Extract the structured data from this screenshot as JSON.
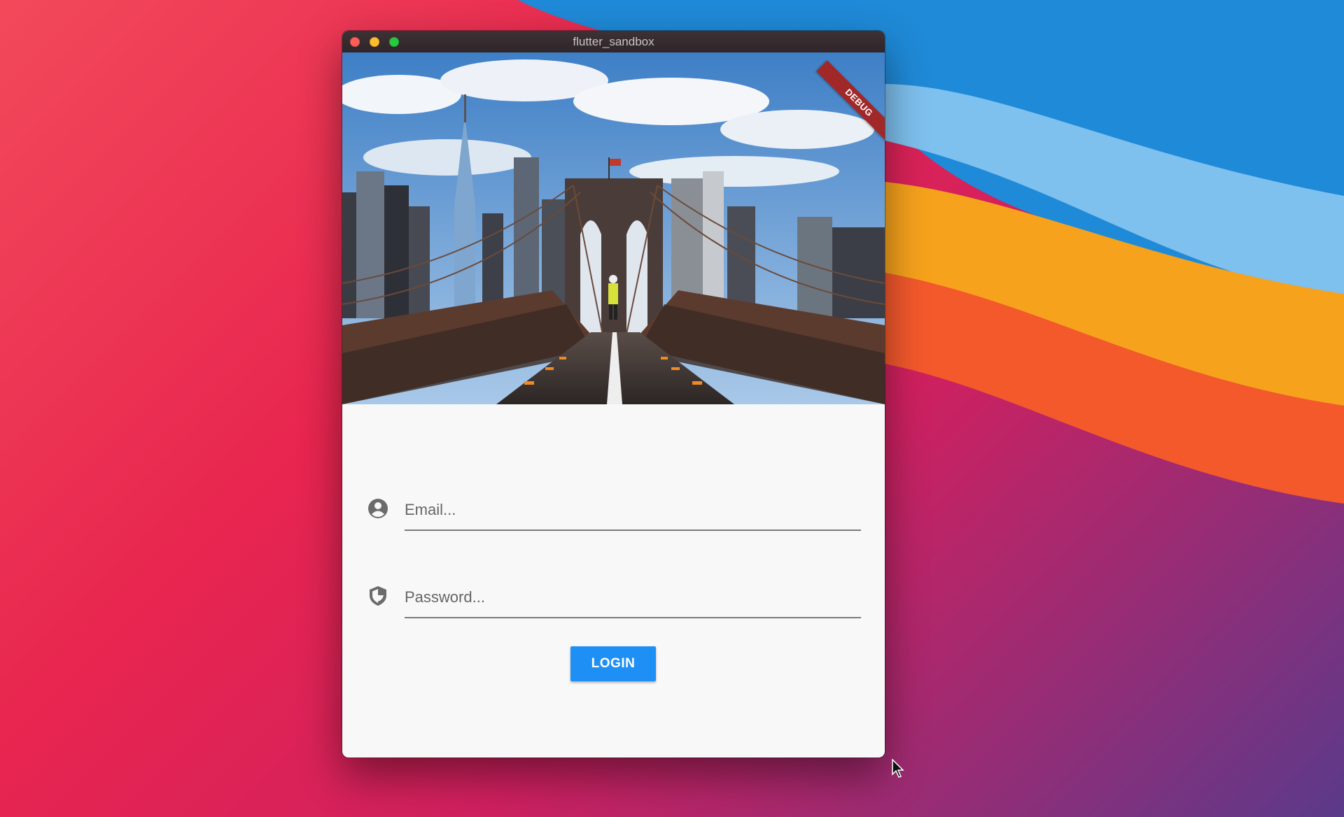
{
  "window": {
    "title": "flutter_sandbox",
    "debug_banner": "DEBUG"
  },
  "login_form": {
    "email_placeholder": "Email...",
    "password_placeholder": "Password...",
    "login_label": "LOGIN"
  },
  "icons": {
    "email": "account-circle-icon",
    "password": "shield-icon"
  },
  "colors": {
    "login_button": "#1e90f5",
    "debug_banner": "#a02828"
  }
}
